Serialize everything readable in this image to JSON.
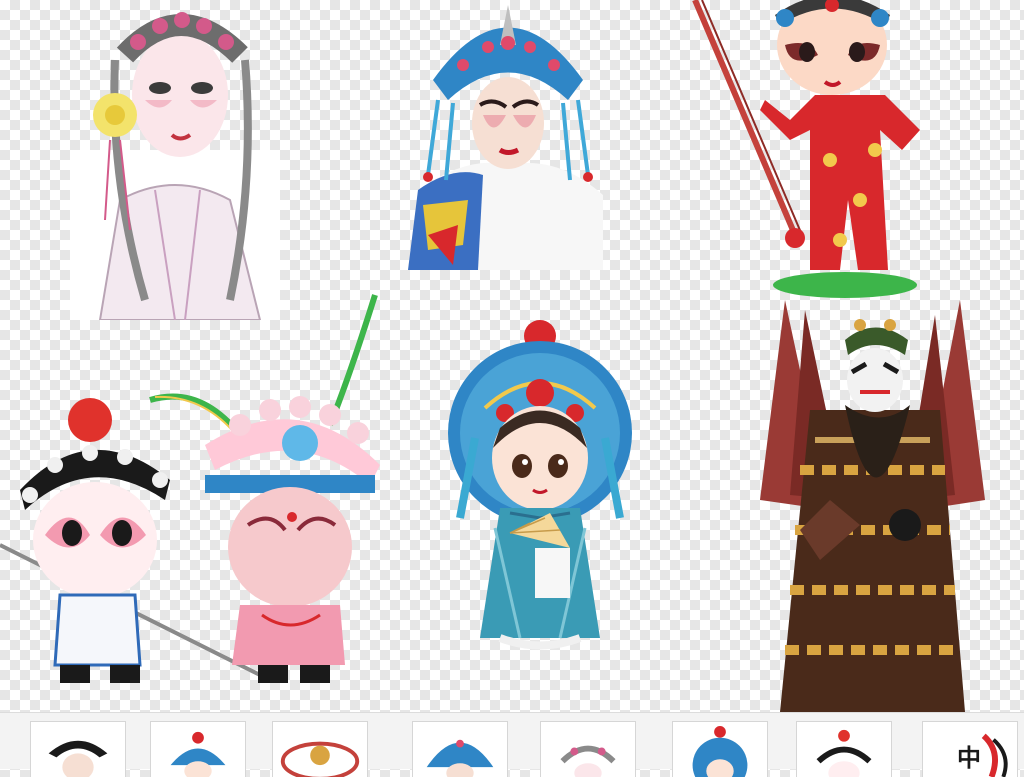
{
  "gallery": {
    "figures": [
      {
        "name": "opera-lady-sketch",
        "icon": "opera-lady-sketch-icon"
      },
      {
        "name": "opera-queen-phoenix-crown",
        "icon": "phoenix-crown-icon"
      },
      {
        "name": "cartoon-acrobat-on-rope",
        "icon": "cartoon-acrobat-icon"
      },
      {
        "name": "cartoon-opera-duo",
        "icon": "cartoon-duo-icon"
      },
      {
        "name": "cartoon-lady-with-fan",
        "icon": "cartoon-fan-lady-icon"
      },
      {
        "name": "general-with-banners",
        "icon": "opera-general-icon"
      }
    ],
    "thumbnails": [
      {
        "icon": "thumb-headdress-icon"
      },
      {
        "icon": "thumb-blue-helmet-icon"
      },
      {
        "icon": "thumb-ring-icon"
      },
      {
        "icon": "thumb-phoenix-crown-icon"
      },
      {
        "icon": "thumb-sketch-icon"
      },
      {
        "icon": "thumb-fan-lady-icon"
      },
      {
        "icon": "thumb-cartoon-icon"
      },
      {
        "icon": "thumb-calligraphy-icon",
        "text": "中"
      }
    ]
  },
  "colors": {
    "opera_red": "#d8282c",
    "opera_blue": "#2f86c6",
    "teal": "#3a9bb5",
    "gold": "#d9a441",
    "face_pink": "#f4b8b8",
    "dark_brown": "#4a2a1a"
  }
}
